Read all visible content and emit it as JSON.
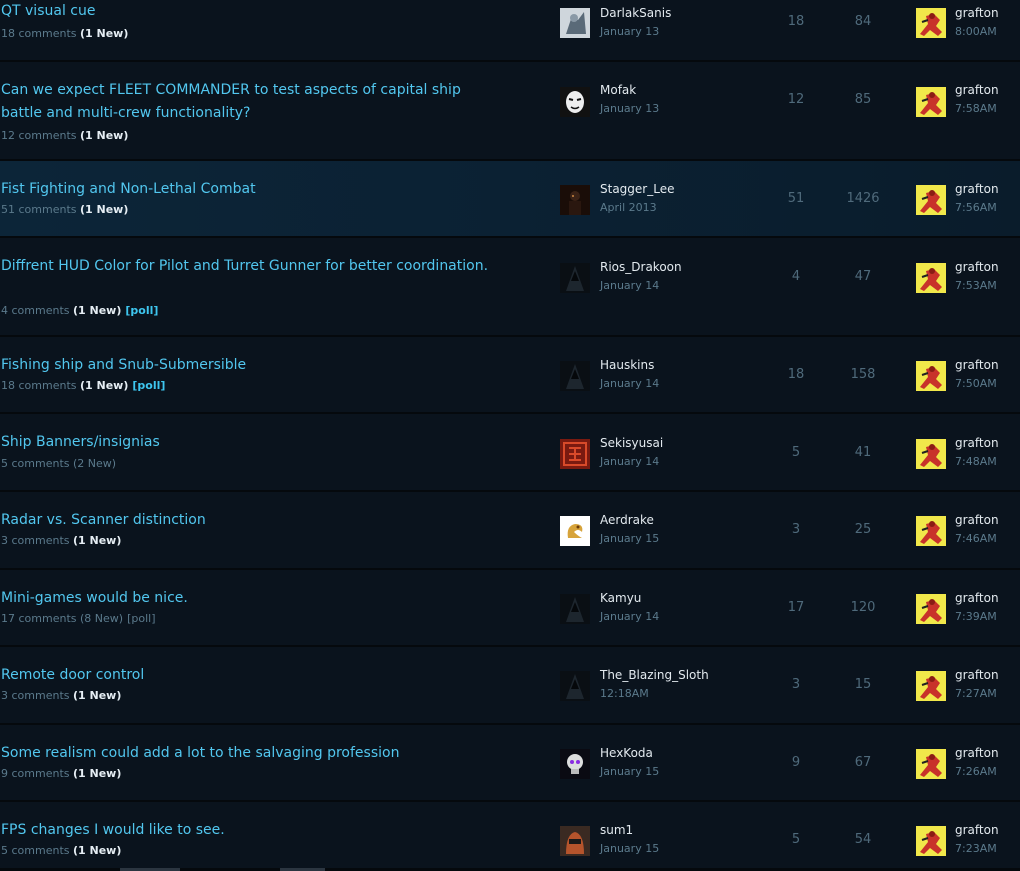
{
  "threads": [
    {
      "title": "QT visual cue",
      "comments": "18 comments",
      "new": "(1 New)",
      "poll": "",
      "author": "DarlakSanis",
      "date": "January 13",
      "replies": "18",
      "views": "84",
      "last_user": "grafton",
      "last_time": "8:00AM",
      "avatar": "gray-figure"
    },
    {
      "title": "Can we expect FLEET COMMANDER to test aspects of capital ship battle and multi-crew functionality?",
      "comments": "12 comments",
      "new": "(1 New)",
      "poll": "",
      "author": "Mofak",
      "date": "January 13",
      "replies": "12",
      "views": "85",
      "last_user": "grafton",
      "last_time": "7:58AM",
      "avatar": "mask"
    },
    {
      "title": "Fist Fighting and Non-Lethal Combat",
      "comments": "51 comments",
      "new": "(1 New)",
      "poll": "",
      "author": "Stagger_Lee",
      "date": "April 2013",
      "replies": "51",
      "views": "1426",
      "last_user": "grafton",
      "last_time": "7:56AM",
      "avatar": "dark-figure"
    },
    {
      "title": "Diffrent HUD Color for Pilot and Turret Gunner for better coordination.",
      "comments": "4 comments",
      "new": "(1 New)",
      "poll": "[poll]",
      "author": "Rios_Drakoon",
      "date": "January 14",
      "replies": "4",
      "views": "47",
      "last_user": "grafton",
      "last_time": "7:53AM",
      "avatar": "hood"
    },
    {
      "title": "Fishing ship and Snub-Submersible",
      "comments": "18 comments",
      "new": "(1 New)",
      "poll": "[poll]",
      "author": "Hauskins",
      "date": "January 14",
      "replies": "18",
      "views": "158",
      "last_user": "grafton",
      "last_time": "7:50AM",
      "avatar": "hood"
    },
    {
      "title": "Ship Banners/insignias",
      "comments": "5 comments",
      "new": "(2 New)",
      "poll": "",
      "author": "Sekisyusai",
      "date": "January 14",
      "replies": "5",
      "views": "41",
      "last_user": "grafton",
      "last_time": "7:48AM",
      "avatar": "red-glyph"
    },
    {
      "title": "Radar vs. Scanner distinction",
      "comments": "3 comments",
      "new": "(1 New)",
      "poll": "",
      "author": "Aerdrake",
      "date": "January 15",
      "replies": "3",
      "views": "25",
      "last_user": "grafton",
      "last_time": "7:46AM",
      "avatar": "dragon"
    },
    {
      "title": "Mini-games would be nice.",
      "comments": "17 comments",
      "new": "(8 New)",
      "poll": "[poll]",
      "author": "Kamyu",
      "date": "January 14",
      "replies": "17",
      "views": "120",
      "last_user": "grafton",
      "last_time": "7:39AM",
      "avatar": "hood"
    },
    {
      "title": "Remote door control",
      "comments": "3 comments",
      "new": "(1 New)",
      "poll": "",
      "author": "The_Blazing_Sloth",
      "date": "12:18AM",
      "replies": "3",
      "views": "15",
      "last_user": "grafton",
      "last_time": "7:27AM",
      "avatar": "hood"
    },
    {
      "title": "Some realism could add a lot to the salvaging profession",
      "comments": "9 comments",
      "new": "(1 New)",
      "poll": "",
      "author": "HexKoda",
      "date": "January 15",
      "replies": "9",
      "views": "67",
      "last_user": "grafton",
      "last_time": "7:26AM",
      "avatar": "skull"
    },
    {
      "title": "FPS changes I would like to see.",
      "comments": "5 comments",
      "new": "(1 New)",
      "poll": "",
      "author": "sum1",
      "date": "January 15",
      "replies": "5",
      "views": "54",
      "last_user": "grafton",
      "last_time": "7:23AM",
      "avatar": "helmet"
    }
  ],
  "colors": {
    "title": "#52c7ef",
    "background": "#0a1119",
    "highlight_row": "#0c2538",
    "new_badge": "#e6eef4",
    "poll_badge": "#3ec6ef"
  }
}
